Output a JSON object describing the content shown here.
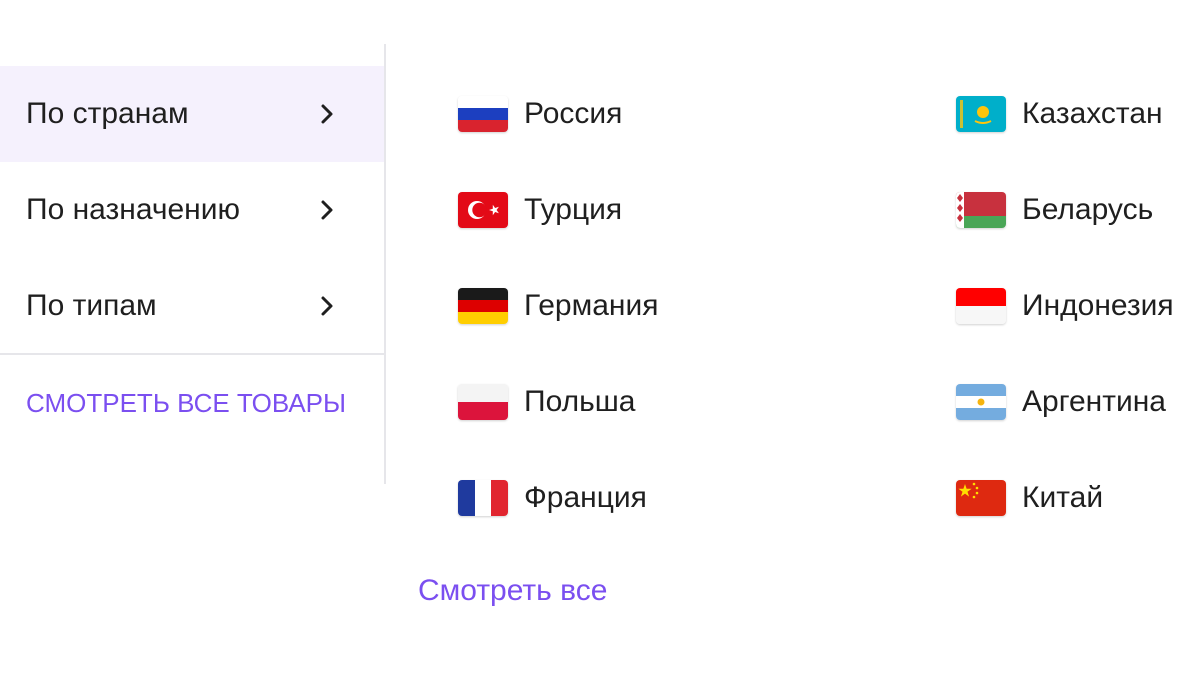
{
  "categories": [
    {
      "label": "По странам",
      "active": true
    },
    {
      "label": "По назначению",
      "active": false
    },
    {
      "label": "По типам",
      "active": false
    }
  ],
  "see_all_goods_label": "Смотреть все товары",
  "countries_left": [
    {
      "name": "Россия",
      "flag": "russia-flag-icon"
    },
    {
      "name": "Турция",
      "flag": "turkey-flag-icon"
    },
    {
      "name": "Германия",
      "flag": "germany-flag-icon"
    },
    {
      "name": "Польша",
      "flag": "poland-flag-icon"
    },
    {
      "name": "Франция",
      "flag": "france-flag-icon"
    }
  ],
  "countries_right": [
    {
      "name": "Казахстан",
      "flag": "kazakhstan-flag-icon"
    },
    {
      "name": "Беларусь",
      "flag": "belarus-flag-icon"
    },
    {
      "name": "Индонезия",
      "flag": "indonesia-flag-icon"
    },
    {
      "name": "Аргентина",
      "flag": "argentina-flag-icon"
    },
    {
      "name": "Китай",
      "flag": "china-flag-icon"
    }
  ],
  "see_all_label": "Смотреть все",
  "colors": {
    "accent": "#7b4ff0",
    "active_bg": "#f5f1fd",
    "text": "#1f1f1f",
    "divider": "#e6e6ea"
  }
}
